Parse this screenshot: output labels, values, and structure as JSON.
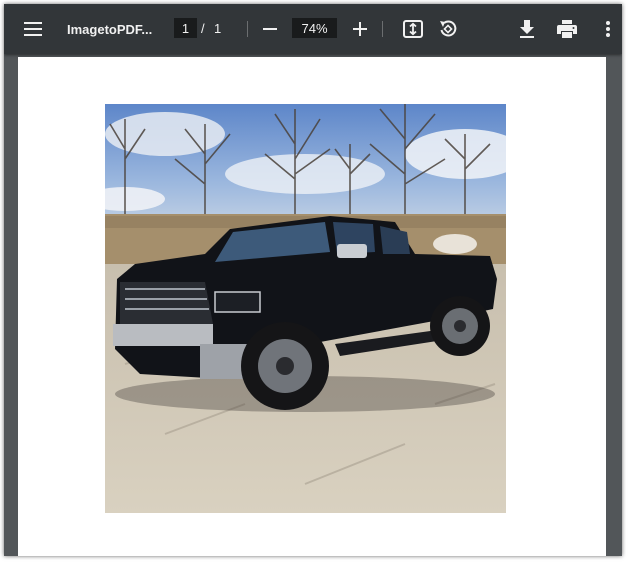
{
  "toolbar": {
    "menu_icon": "hamburger-menu-icon",
    "title": "ImagetoPDF...",
    "page_current": "1",
    "page_separator": "/",
    "page_total": "1",
    "zoom_out_icon": "minus-icon",
    "zoom_value": "74%",
    "zoom_in_icon": "plus-icon",
    "fit_icon": "fit-to-page-icon",
    "rotate_icon": "rotate-counterclockwise-icon",
    "download_icon": "download-icon",
    "print_icon": "print-icon",
    "more_icon": "more-vertical-icon"
  },
  "document": {
    "image_subject": "black-pickup-truck-photo"
  },
  "colors": {
    "toolbar_bg": "#323639",
    "viewer_bg": "#525659",
    "input_bg": "#191b1c",
    "page_bg": "#ffffff",
    "icon": "#f1f1f1"
  }
}
